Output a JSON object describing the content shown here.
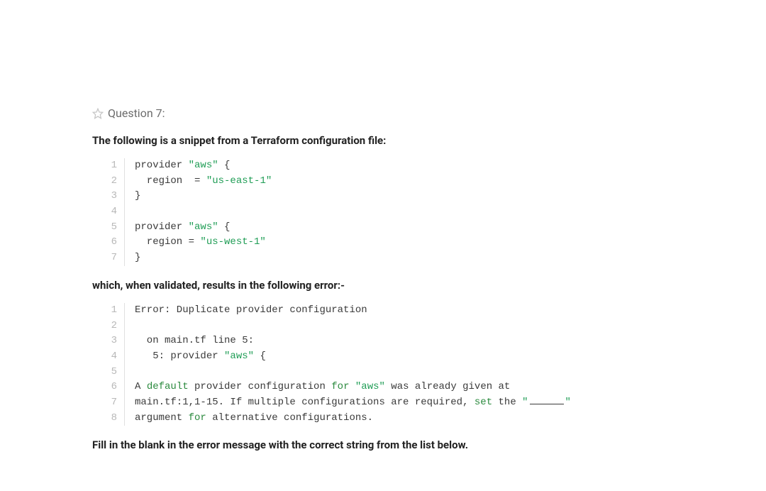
{
  "header": {
    "question_label": "Question 7:"
  },
  "intro": "The following is a snippet from a Terraform configuration file:",
  "code1": {
    "lines": [
      {
        "n": "1",
        "tokens": [
          {
            "t": "provider ",
            "c": ""
          },
          {
            "t": "\"aws\"",
            "c": "str"
          },
          {
            "t": " {",
            "c": ""
          }
        ]
      },
      {
        "n": "2",
        "tokens": [
          {
            "t": "  region  = ",
            "c": ""
          },
          {
            "t": "\"us-east-1\"",
            "c": "str"
          }
        ]
      },
      {
        "n": "3",
        "tokens": [
          {
            "t": "}",
            "c": ""
          }
        ]
      },
      {
        "n": "4",
        "tokens": [
          {
            "t": "",
            "c": ""
          }
        ]
      },
      {
        "n": "5",
        "tokens": [
          {
            "t": "provider ",
            "c": ""
          },
          {
            "t": "\"aws\"",
            "c": "str"
          },
          {
            "t": " {",
            "c": ""
          }
        ]
      },
      {
        "n": "6",
        "tokens": [
          {
            "t": "  region = ",
            "c": ""
          },
          {
            "t": "\"us-west-1\"",
            "c": "str"
          }
        ]
      },
      {
        "n": "7",
        "tokens": [
          {
            "t": "}",
            "c": ""
          }
        ]
      }
    ]
  },
  "middle": "which, when validated, results in the following error:-",
  "code2": {
    "lines": [
      {
        "n": "1",
        "tokens": [
          {
            "t": "Error: Duplicate provider configuration",
            "c": ""
          }
        ]
      },
      {
        "n": "2",
        "tokens": [
          {
            "t": "",
            "c": ""
          }
        ]
      },
      {
        "n": "3",
        "tokens": [
          {
            "t": "  on main.tf line 5:",
            "c": ""
          }
        ]
      },
      {
        "n": "4",
        "tokens": [
          {
            "t": "   5: provider ",
            "c": ""
          },
          {
            "t": "\"aws\"",
            "c": "str"
          },
          {
            "t": " {",
            "c": ""
          }
        ]
      },
      {
        "n": "5",
        "tokens": [
          {
            "t": "",
            "c": ""
          }
        ]
      },
      {
        "n": "6",
        "tokens": [
          {
            "t": "A ",
            "c": ""
          },
          {
            "t": "default",
            "c": "kw"
          },
          {
            "t": " provider configuration ",
            "c": ""
          },
          {
            "t": "for",
            "c": "kw"
          },
          {
            "t": " ",
            "c": ""
          },
          {
            "t": "\"aws\"",
            "c": "str"
          },
          {
            "t": " was already given at",
            "c": ""
          }
        ]
      },
      {
        "n": "7",
        "tokens": [
          {
            "t": "main.tf:1,1-15. If multiple configurations are required, ",
            "c": ""
          },
          {
            "t": "set",
            "c": "kw"
          },
          {
            "t": " the ",
            "c": ""
          },
          {
            "t": "\"",
            "c": "str"
          },
          {
            "t": "",
            "c": "blank"
          },
          {
            "t": "\"",
            "c": "str"
          }
        ]
      },
      {
        "n": "8",
        "tokens": [
          {
            "t": "argument ",
            "c": ""
          },
          {
            "t": "for",
            "c": "kw"
          },
          {
            "t": " alternative configurations.",
            "c": ""
          }
        ]
      }
    ]
  },
  "final": "Fill in the blank in the error message with the correct string from the list below."
}
